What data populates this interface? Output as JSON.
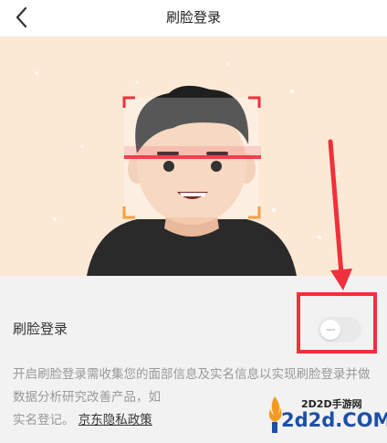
{
  "header": {
    "title": "刷脸登录"
  },
  "setting": {
    "label": "刷脸登录",
    "enabled": false
  },
  "description": {
    "text": "开启刷脸登录需收集您的面部信息及实名信息以实现刷脸登录并做数据分析研究改善产品，如",
    "tail": "实名登记。",
    "policy_link": "京东隐私政策"
  },
  "watermark": {
    "cn": "2D2D手游网",
    "en": "2d2d.COM"
  },
  "colors": {
    "accent_red": "#f0303c",
    "hero_bg": "#fbe9d6",
    "scan_line": "#ee2f40",
    "corner_orange": "#f5a040"
  },
  "icons": {
    "back": "chevron-left-icon",
    "face": "face-illustration",
    "arrow": "red-arrow-annotation"
  }
}
